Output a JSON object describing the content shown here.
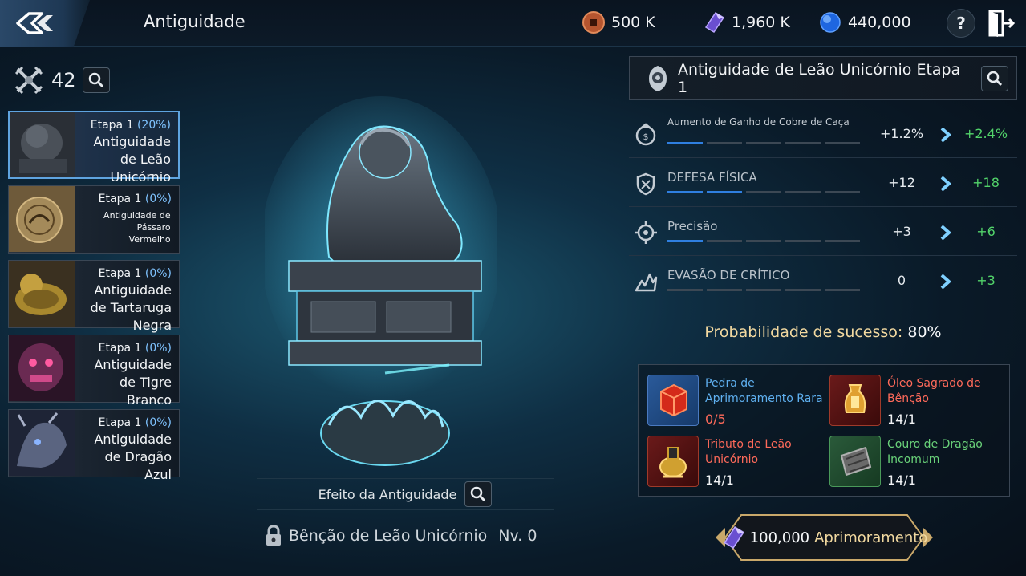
{
  "header": {
    "title": "Antiguidade",
    "currencies": [
      {
        "icon": "copper-coin-icon",
        "value": "500 K"
      },
      {
        "icon": "purple-crystal-icon",
        "value": "1,960 K"
      },
      {
        "icon": "blue-orb-icon",
        "value": "440,000"
      }
    ],
    "help_label": "?"
  },
  "left": {
    "count": "42",
    "items": [
      {
        "stage": "Etapa 1",
        "pct": "(20%)",
        "name": "Antiguidade de Leão Unicórnio",
        "selected": true
      },
      {
        "stage": "Etapa 1",
        "pct": "(0%)",
        "name": "Antiguidade de Pássaro Vermelho"
      },
      {
        "stage": "Etapa 1",
        "pct": "(0%)",
        "name": "Antiguidade de Tartaruga Negra"
      },
      {
        "stage": "Etapa 1",
        "pct": "(0%)",
        "name": "Antiguidade de Tigre Branco"
      },
      {
        "stage": "Etapa 1",
        "pct": "(0%)",
        "name": "Antiguidade de Dragão Azul"
      }
    ]
  },
  "center": {
    "effect_label": "Efeito da Antiguidade",
    "blessing_name": "Bênção de Leão Unicórnio",
    "blessing_level": "Nv. 0"
  },
  "detail": {
    "title": "Antiguidade de Leão Unicórnio Etapa 1",
    "stats": [
      {
        "name": "Aumento de Ganho de Cobre de Caça",
        "current": "+1.2%",
        "next": "+2.4%",
        "filled": 1,
        "total": 5
      },
      {
        "name": "DEFESA FÍSICA",
        "current": "+12",
        "next": "+18",
        "filled": 2,
        "total": 5
      },
      {
        "name": "Precisão",
        "current": "+3",
        "next": "+6",
        "filled": 1,
        "total": 5
      },
      {
        "name": "EVASÃO DE CRÍTICO",
        "current": "0",
        "next": "+3",
        "filled": 0,
        "total": 5
      }
    ],
    "probability_label": "Probabilidade de sucesso:",
    "probability_value": "80%",
    "materials": [
      {
        "name": "Pedra de Aprimoramento Rara",
        "qty": "0/5",
        "name_color": "#5fb0f0",
        "qty_low": true
      },
      {
        "name": "Óleo Sagrado de Bênção",
        "qty": "14/1",
        "name_color": "#ff6a5a"
      },
      {
        "name": "Tributo de Leão Unicórnio",
        "qty": "14/1",
        "name_color": "#ff6a5a"
      },
      {
        "name": "Couro de Dragão Incomum",
        "qty": "14/1",
        "name_color": "#6ad37a"
      }
    ],
    "upgrade_cost": "100,000",
    "upgrade_label": "Aprimoramento"
  },
  "colors": {
    "accent_blue": "#2f7fe0",
    "increase_green": "#52d36a",
    "gold_text": "#f2d9a0",
    "warning_red": "#ff6a5a"
  }
}
